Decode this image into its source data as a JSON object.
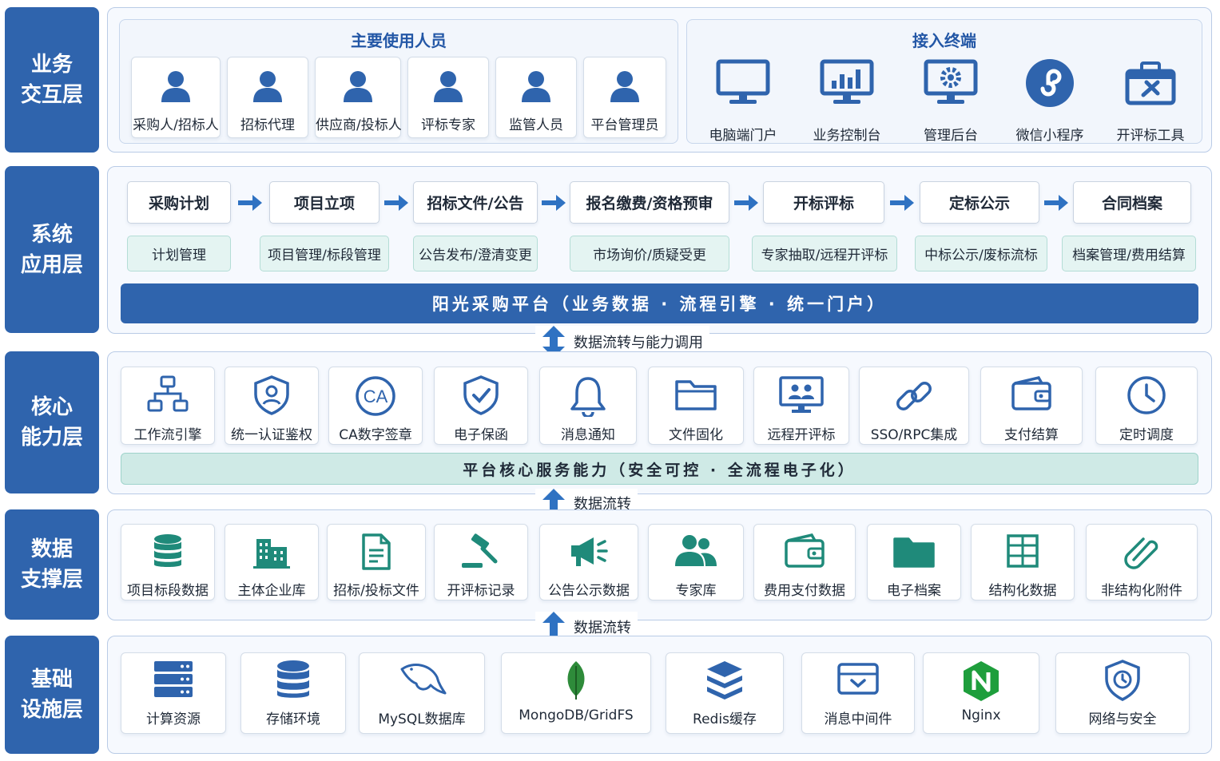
{
  "layers": {
    "interaction": "业务\n交互层",
    "application": "系统\n应用层",
    "core": "核心\n能力层",
    "data": "数据\n支撑层",
    "infra": "基础\n设施层"
  },
  "users": {
    "title": "主要使用人员",
    "items": [
      "采购人/招标人",
      "招标代理",
      "供应商/投标人",
      "评标专家",
      "监管人员",
      "平台管理员"
    ]
  },
  "terminals": {
    "title": "接入终端",
    "items": [
      "电脑端门户",
      "业务控制台",
      "管理后台",
      "微信小程序",
      "开评标工具"
    ]
  },
  "flow": {
    "stages": [
      "采购计划",
      "项目立项",
      "招标文件/公告",
      "报名缴费/资格预审",
      "开标评标",
      "定标公示",
      "合同档案"
    ],
    "subs": [
      "计划管理",
      "项目管理/标段管理",
      "公告发布/澄清变更",
      "市场询价/质疑受更",
      "专家抽取/远程开评标",
      "中标公示/废标流标",
      "档案管理/费用结算"
    ]
  },
  "platform_bar": "阳光采购平台（业务数据 · 流程引擎 · 统一门户）",
  "connectors": {
    "c1": "数据流转与能力调用",
    "c2": "数据流转",
    "c3": "数据流转"
  },
  "core": {
    "items": [
      "工作流引擎",
      "统一认证鉴权",
      "CA数字签章",
      "电子保函",
      "消息通知",
      "文件固化",
      "远程开评标",
      "SSO/RPC集成",
      "支付结算",
      "定时调度"
    ],
    "bar": "平台核心服务能力（安全可控 · 全流程电子化）"
  },
  "data_items": [
    "项目标段数据",
    "主体企业库",
    "招标/投标文件",
    "开评标记录",
    "公告公示数据",
    "专家库",
    "费用支付数据",
    "电子档案",
    "结构化数据",
    "非结构化附件"
  ],
  "infra_items": [
    "计算资源",
    "存储环境",
    "MySQL数据库",
    "MongoDB/GridFS",
    "Redis缓存",
    "消息中间件",
    "Nginx",
    "网络与安全"
  ],
  "icons": {
    "users": "person-icon",
    "terminals": [
      "monitor-icon",
      "dashboard-monitor-icon",
      "gear-monitor-icon",
      "miniprogram-icon",
      "toolbox-icon"
    ],
    "core": [
      "workflow-icon",
      "shield-user-icon",
      "ca-badge-icon",
      "shield-check-icon",
      "bell-icon",
      "folder-icon",
      "remote-meeting-icon",
      "link-icon",
      "wallet-icon",
      "clock-icon"
    ],
    "data": [
      "database-icon",
      "building-icon",
      "document-icon",
      "gavel-icon",
      "megaphone-icon",
      "people-icon",
      "wallet-icon",
      "folder-icon",
      "table-icon",
      "paperclip-icon"
    ],
    "infra": [
      "server-icon",
      "database-icon",
      "dolphin-icon",
      "leaf-icon",
      "layers-icon",
      "inbox-icon",
      "nginx-icon",
      "shield-clock-icon"
    ]
  },
  "colors": {
    "primary": "#2f64ad",
    "teal": "#1f8a7a",
    "teal_bar": "#cfeae6",
    "arrow": "#2f72c2"
  }
}
